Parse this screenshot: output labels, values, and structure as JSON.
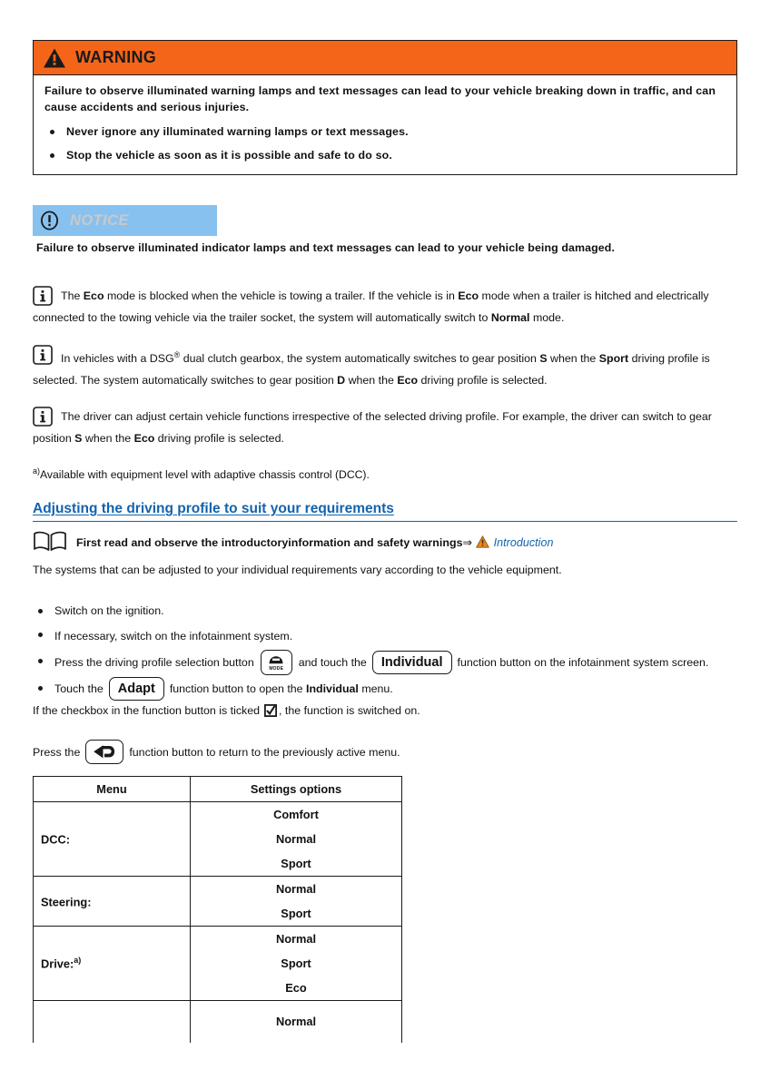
{
  "warning": {
    "icon": "warning-triangle-icon",
    "title": "WARNING",
    "paragraph": "Failure to observe illuminated warning lamps and text messages can lead to your vehicle breaking down in traffic, and can cause accidents and serious injuries.",
    "bullets": [
      "Never ignore any illuminated warning lamps or text messages.",
      "Stop the vehicle as soon as it is possible and safe to do so."
    ],
    "header_bg": "#f4651a",
    "border_color": "#1a1a1a"
  },
  "notice": {
    "icon": "exclamation-circle-icon",
    "title": "NOTICE",
    "header_bg": "#87c1ef",
    "title_color": "#c9c9c9",
    "body": "Failure to observe illuminated indicator lamps and text messages can lead to your vehicle being damaged."
  },
  "info_blocks": [
    {
      "icon": "info-i-icon",
      "segments": [
        {
          "t": "The ",
          "b": false
        },
        {
          "t": "Eco",
          "b": true
        },
        {
          "t": " mode is blocked when the vehicle is towing a trailer. If the vehicle is in ",
          "b": false
        },
        {
          "t": "Eco",
          "b": true
        },
        {
          "t": " mode when a trailer is hitched and electrically connected to the towing vehicle via the trailer socket, the system will automatically switch to ",
          "b": false
        },
        {
          "t": "Normal",
          "b": true
        },
        {
          "t": " mode.",
          "b": false
        }
      ]
    },
    {
      "icon": "info-i-icon",
      "segments": [
        {
          "t": "In vehicles with a DSG",
          "b": false
        },
        {
          "t": "®",
          "b": false,
          "sup": true
        },
        {
          "t": " dual clutch gearbox, the system automatically switches to gear position ",
          "b": false
        },
        {
          "t": "S",
          "b": true
        },
        {
          "t": " when the ",
          "b": false
        },
        {
          "t": "Sport",
          "b": true
        },
        {
          "t": " driving profile is selected. The system automatically switches to gear position ",
          "b": false
        },
        {
          "t": "D",
          "b": true
        },
        {
          "t": " when the ",
          "b": false
        },
        {
          "t": "Eco",
          "b": true
        },
        {
          "t": " driving profile is selected.",
          "b": false
        }
      ]
    },
    {
      "icon": "info-i-icon",
      "segments": [
        {
          "t": "The driver can adjust certain vehicle functions irrespective of the selected driving profile. For example, the driver can switch to gear position ",
          "b": false
        },
        {
          "t": "S",
          "b": true
        },
        {
          "t": " when the ",
          "b": false
        },
        {
          "t": "Eco",
          "b": true
        },
        {
          "t": " driving profile is selected.",
          "b": false
        }
      ]
    }
  ],
  "footnote": {
    "marker": "a)",
    "text": "Available with equipment level with adaptive chassis control (DCC)."
  },
  "section": {
    "heading": "Adjusting the driving profile to suit your requirements",
    "heading_color": "#1263ad"
  },
  "read_first": {
    "book_icon": "open-book-icon",
    "text": "First read and observe the introductoryinformation and safety warnings",
    "arrow": "⇒",
    "warning_icon": "warning-triangle-small-icon",
    "link": "Introduction",
    "link_color": "#1263ad"
  },
  "intro_paragraph": "The systems that can be adjusted to your individual requirements vary according to the vehicle equipment.",
  "steps": [
    {
      "text_before": "Switch on the ignition.",
      "text_after": ""
    },
    {
      "text_before": "If necessary, switch on the infotainment system.",
      "text_after": ""
    },
    {
      "text_before": "Press the driving profile selection button",
      "chip_mode_label": "MODE",
      "text_middle": "and touch the",
      "chip_label": "Individual",
      "text_after": "function button on the infotainment system screen."
    },
    {
      "text_before": "Touch the",
      "chip_label": "Adapt",
      "text_after_1": "function button to open the",
      "bold_word": "Individual",
      "text_after_2": "menu."
    }
  ],
  "checkbox_line": {
    "before": "If the checkbox in the function button is ticked",
    "icon": "checked-checkbox-icon",
    "after": ", the function is switched on."
  },
  "back_line": {
    "before": "Press the",
    "icon": "back-arrow-icon",
    "after": "function button to return to the previously active menu."
  },
  "table": {
    "headers": [
      "Menu",
      "Settings options"
    ],
    "rows": [
      {
        "menu": "DCC:",
        "menu_sup": "",
        "options": [
          "Comfort",
          "Normal",
          "Sport"
        ]
      },
      {
        "menu": "Steering:",
        "menu_sup": "",
        "options": [
          "Normal",
          "Sport"
        ]
      },
      {
        "menu": "Drive:",
        "menu_sup": "a)",
        "options": [
          "Normal",
          "Sport",
          "Eco"
        ]
      },
      {
        "menu": "",
        "menu_sup": "",
        "options": [
          "Normal"
        ]
      }
    ]
  }
}
